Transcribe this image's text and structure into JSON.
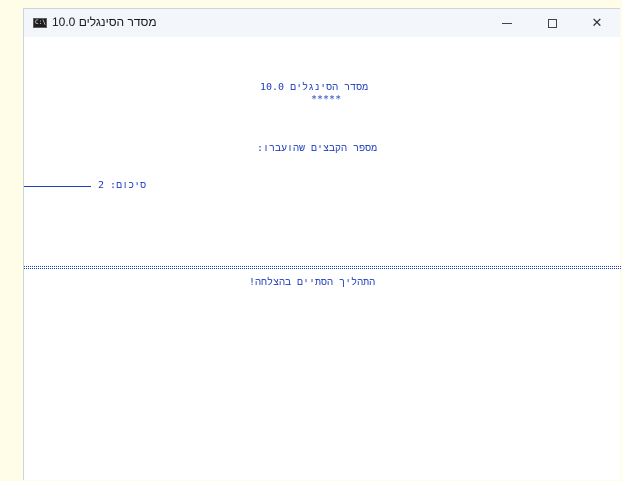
{
  "window": {
    "title": "מסדר הסינגלים 10.0",
    "icon": "command-prompt-icon",
    "icon_text": "C:\\"
  },
  "controls": {
    "minimize_glyph": "—",
    "maximize_glyph": "☐",
    "close_glyph": "✕"
  },
  "console": {
    "header_title": "מסדר הסינגלים 10.0",
    "header_stars": "*****",
    "files_label": "מספר הקבצים שהועברו:",
    "summary": "סיכום: 2",
    "success": "התהליך הסתיים בהצלחה!"
  },
  "colors": {
    "console_text": "#1f3fbf",
    "desktop": "#fffde8",
    "titlebar": "#f3f6fa"
  }
}
